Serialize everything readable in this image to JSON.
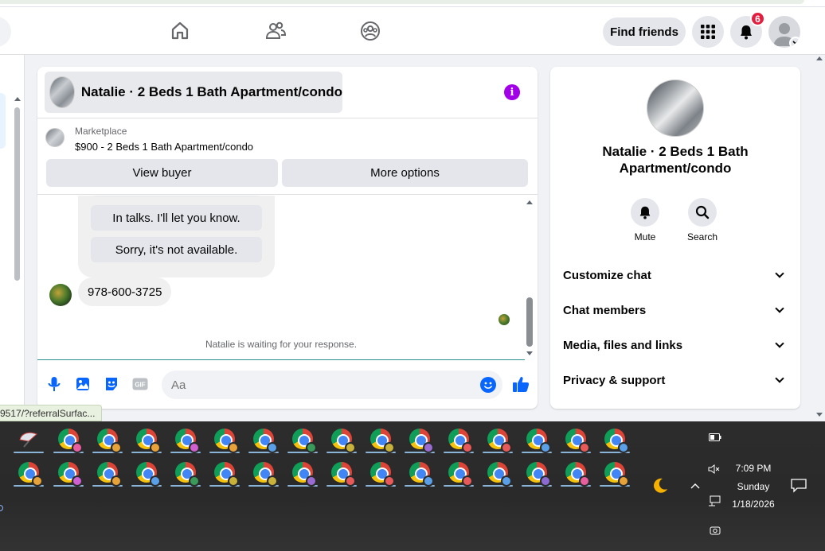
{
  "topnav": {
    "find_friends_label": "Find friends",
    "notification_count": "6",
    "icons": [
      "home-icon",
      "friends-icon",
      "groups-icon",
      "menu-grid-icon",
      "bell-icon"
    ]
  },
  "chat": {
    "title": "Natalie · 2 Beds 1 Bath Apartment/condo",
    "listing": {
      "source": "Marketplace",
      "title": "$900 - 2 Beds 1 Bath Apartment/condo"
    },
    "buttons": {
      "view_buyer": "View buyer",
      "more_options": "More options"
    },
    "quick_replies": [
      "In talks. I'll let you know.",
      "Sorry, it's not available."
    ],
    "messages": [
      {
        "sender": "Natalie",
        "text": "978-600-3725"
      }
    ],
    "waiting_note": "Natalie is waiting for your response.",
    "composer": {
      "placeholder": "Aa"
    }
  },
  "details": {
    "title": "Natalie · 2 Beds 1 Bath Apartment/condo",
    "actions": [
      {
        "label": "Mute",
        "icon": "bell-icon"
      },
      {
        "label": "Search",
        "icon": "search-icon"
      }
    ],
    "sections": [
      "Customize chat",
      "Chat members",
      "Media, files and links",
      "Privacy & support"
    ]
  },
  "status_bar": {
    "url": "9517/?referralSurfac..."
  },
  "taskbar": {
    "clock": {
      "time": "7:09 PM",
      "day": "Sunday",
      "date": "1/18/2026"
    }
  },
  "colors": {
    "accent": "#0866ff",
    "info": "#a200e8",
    "badge": "#e41e3f"
  }
}
